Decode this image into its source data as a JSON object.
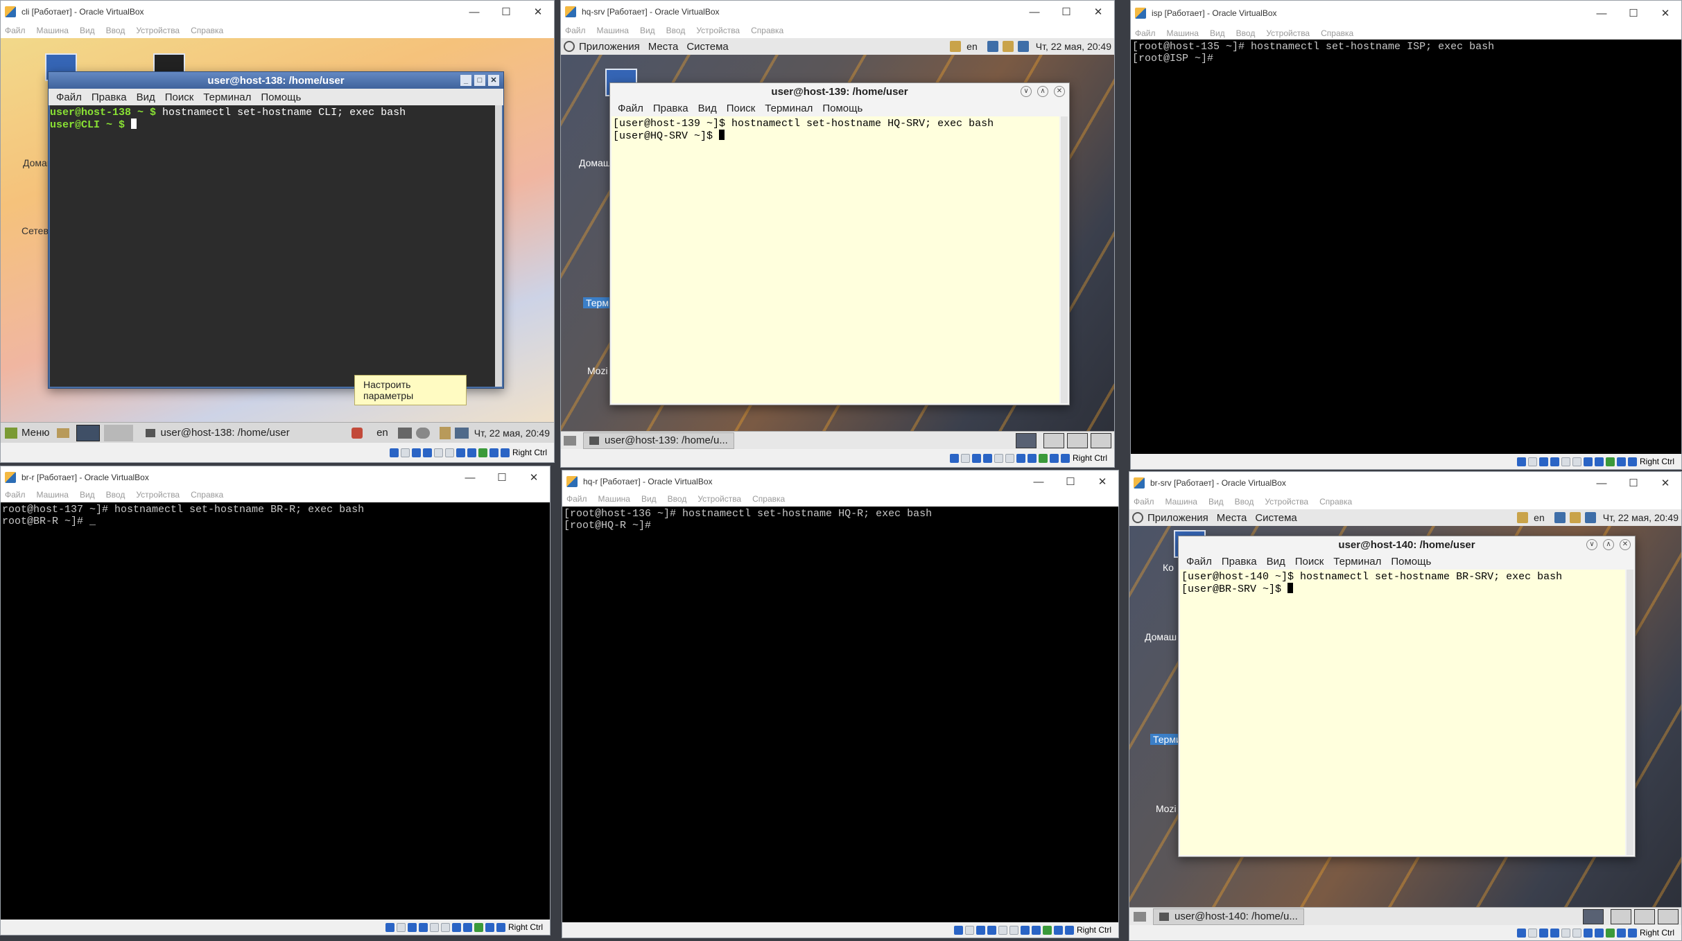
{
  "vbox_menu": [
    "Файл",
    "Машина",
    "Вид",
    "Ввод",
    "Устройства",
    "Справка"
  ],
  "host_key": "Right Ctrl",
  "windows": {
    "cli": {
      "title": "cli [Работает] - Oracle VirtualBox"
    },
    "hq_srv": {
      "title": "hq-srv [Работает] - Oracle VirtualBox"
    },
    "isp": {
      "title": "isp [Работает] - Oracle VirtualBox"
    },
    "br_r": {
      "title": "br-r [Работает] - Oracle VirtualBox"
    },
    "hq_r": {
      "title": "hq-r [Работает] - Oracle VirtualBox"
    },
    "br_srv": {
      "title": "br-srv [Работает] - Oracle VirtualBox"
    }
  },
  "terminal_menu": [
    "Файл",
    "Правка",
    "Вид",
    "Поиск",
    "Терминал",
    "Помощь"
  ],
  "gnome_panel": {
    "apps": "Приложения",
    "places": "Места",
    "system": "Система",
    "lang": "en",
    "datetime": "Чт, 22 мая, 20:49"
  },
  "cli": {
    "terminal_title": "user@host-138: /home/user",
    "prompt1_user": "user@host-138",
    "prompt1_rest": " ~ $ ",
    "command1": "hostnamectl set-hostname CLI; exec bash",
    "prompt2_user": "user@CLI",
    "prompt2_rest": " ~ $ ",
    "tooltip": "Настроить параметры",
    "panel": {
      "menu": "Меню",
      "task": "user@host-138: /home/user",
      "lang": "en",
      "datetime": "Чт, 22 мая, 20:49"
    }
  },
  "hq_srv": {
    "terminal_title": "user@host-139: /home/user",
    "line1": "[user@host-139 ~]$ hostnamectl set-hostname HQ-SRV; exec bash",
    "line2": "[user@HQ-SRV ~]$ ",
    "task": "user@host-139: /home/u..."
  },
  "isp": {
    "line1": "[root@host-135 ~]# hostnamectl set-hostname ISP; exec bash",
    "line2": "[root@ISP ~]#"
  },
  "br_r": {
    "line1": "root@host-137 ~]# hostnamectl set-hostname BR-R; exec bash",
    "line2": "root@BR-R ~]# _"
  },
  "hq_r": {
    "line1": "[root@host-136 ~]# hostnamectl set-hostname HQ-R; exec bash",
    "line2": "[root@HQ-R ~]#"
  },
  "br_srv": {
    "terminal_title": "user@host-140: /home/user",
    "line1": "[user@host-140 ~]$ hostnamectl set-hostname BR-SRV; exec bash",
    "line2": "[user@BR-SRV ~]$ ",
    "task": "user@host-140: /home/u..."
  },
  "desktop_labels": {
    "home": "Домаш",
    "network": "Сетев",
    "home2": "Домаш",
    "term": "Терми",
    "mozilla": "Mozi",
    "comp": "Ко"
  }
}
